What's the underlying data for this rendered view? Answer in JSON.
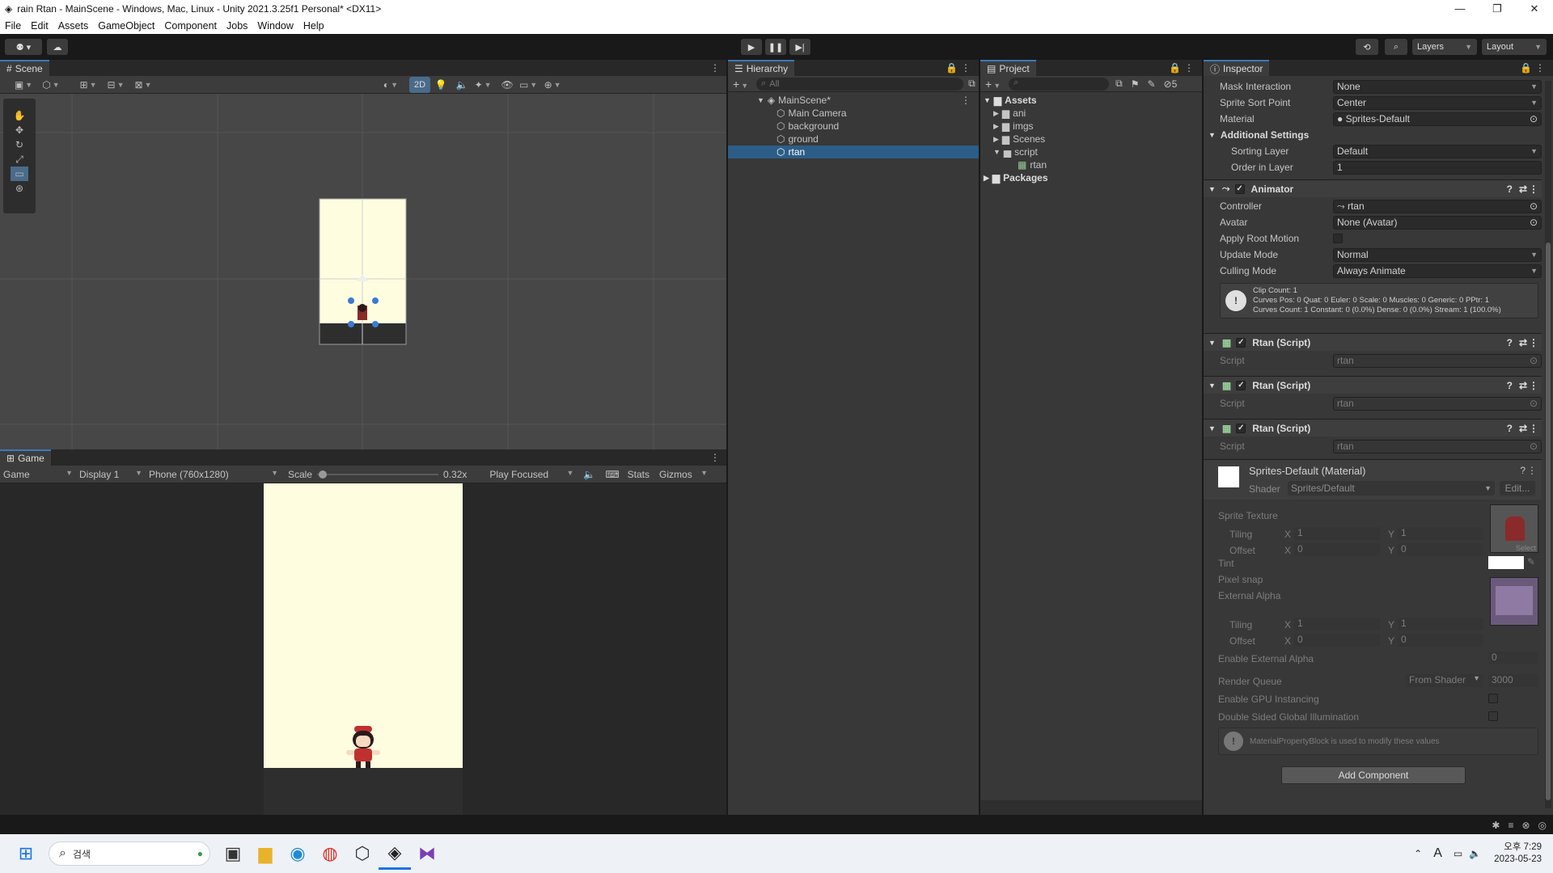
{
  "window": {
    "title": "rain Rtan - MainScene - Windows, Mac, Linux - Unity 2021.3.25f1 Personal* <DX11>"
  },
  "menu": [
    "File",
    "Edit",
    "Assets",
    "GameObject",
    "Component",
    "Jobs",
    "Window",
    "Help"
  ],
  "toolbar": {
    "layers": "Layers",
    "layout": "Layout"
  },
  "scene": {
    "tab": "Scene",
    "mode_2d": "2D"
  },
  "game": {
    "tab": "Game",
    "mode": "Game",
    "display": "Display 1",
    "resolution": "Phone (760x1280)",
    "scale_label": "Scale",
    "scale_value": "0.32x",
    "play_focused": "Play Focused",
    "stats": "Stats",
    "gizmos": "Gizmos"
  },
  "hierarchy": {
    "tab": "Hierarchy",
    "search_placeholder": "All",
    "scene": "MainScene*",
    "items": [
      "Main Camera",
      "background",
      "ground",
      "rtan"
    ],
    "selected": "rtan"
  },
  "project": {
    "tab": "Project",
    "count": "5",
    "assets": "Assets",
    "folders": [
      "ani",
      "imgs",
      "Scenes",
      "script"
    ],
    "script_child": "rtan",
    "packages": "Packages"
  },
  "inspector": {
    "tab": "Inspector",
    "sprite_rows": [
      {
        "label": "Mask Interaction",
        "value": "None"
      },
      {
        "label": "Sprite Sort Point",
        "value": "Center"
      },
      {
        "label": "Material",
        "value": "Sprites-Default"
      }
    ],
    "additional_settings": "Additional Settings",
    "sorting_layer": {
      "label": "Sorting Layer",
      "value": "Default"
    },
    "order_in_layer": {
      "label": "Order in Layer",
      "value": "1"
    },
    "animator": {
      "title": "Animator",
      "controller": {
        "label": "Controller",
        "value": "rtan"
      },
      "avatar": {
        "label": "Avatar",
        "value": "None (Avatar)"
      },
      "apply_root_motion": "Apply Root Motion",
      "update_mode": {
        "label": "Update Mode",
        "value": "Normal"
      },
      "culling_mode": {
        "label": "Culling Mode",
        "value": "Always Animate"
      },
      "info_lines": [
        "Clip Count: 1",
        "Curves Pos: 0 Quat: 0 Euler: 0 Scale: 0 Muscles: 0 Generic: 0 PPtr: 1",
        "Curves Count: 1 Constant: 0 (0.0%) Dense: 0 (0.0%) Stream: 1 (100.0%)"
      ]
    },
    "scripts": [
      {
        "title": "Rtan (Script)",
        "label": "Script",
        "value": "rtan"
      },
      {
        "title": "Rtan (Script)",
        "label": "Script",
        "value": "rtan"
      },
      {
        "title": "Rtan (Script)",
        "label": "Script",
        "value": "rtan"
      }
    ],
    "material": {
      "title": "Sprites-Default (Material)",
      "shader_label": "Shader",
      "shader": "Sprites/Default",
      "edit": "Edit...",
      "sprite_texture": "Sprite Texture",
      "tiling": "Tiling",
      "offset": "Offset",
      "x": "X",
      "y": "Y",
      "tiling_values": [
        "1",
        "1"
      ],
      "offset_values": [
        "0",
        "0"
      ],
      "select": "Select",
      "tint": "Tint",
      "pixel_snap": "Pixel snap",
      "external_alpha": "External Alpha",
      "enable_external_alpha": "Enable External Alpha",
      "enable_external_alpha_value": "0",
      "render_queue": "Render Queue",
      "render_queue_mode": "From Shader",
      "render_queue_value": "3000",
      "gpu_instancing": "Enable GPU Instancing",
      "double_sided": "Double Sided Global Illumination",
      "mpb_note": "MaterialPropertyBlock is used to modify these values"
    },
    "add_component": "Add Component"
  },
  "taskbar": {
    "search": "검색",
    "time": "오후 7:29",
    "date": "2023-05-23",
    "ime": "A"
  },
  "colors": {
    "accent": "#2c5d87",
    "panel": "#383838",
    "game_bg": "#fffde0"
  }
}
